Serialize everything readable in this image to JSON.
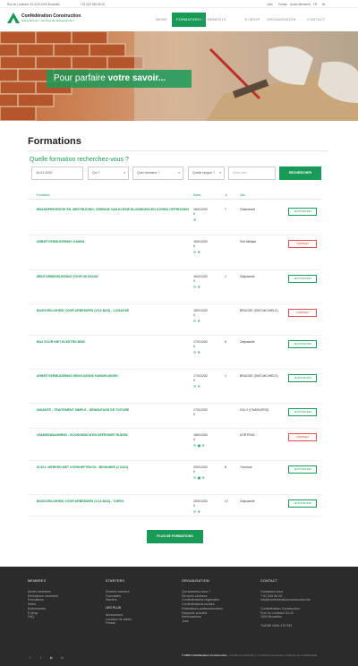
{
  "topbar": {
    "address": "Rue du Lombard, 34-42 B-1000 Bruxelles",
    "phone": "+32 (0)2 545 56 00",
    "links": [
      "Jobs",
      "Presse",
      "Accès Membres",
      "FR",
      "NL"
    ]
  },
  "header": {
    "logo_title": "Confédération Construction",
    "logo_sub": "Entrepreneurs · Services de développement",
    "nav": [
      "NEWS",
      "FORMATIONS",
      "EVENEMENTS",
      "E-SHOP",
      "ORGANISATION",
      "CONTACT"
    ],
    "active_nav": "FORMATIONS"
  },
  "hero": {
    "text_light": "Pour parfaire",
    "text_bold": "votre savoir..."
  },
  "page_title": "Formations",
  "search": {
    "question": "Quelle formation recherchez-vous ?",
    "date": "16-01-2020",
    "who": "Qui ?",
    "domain": "Quel domaine ?",
    "language": "Quelle langue ?",
    "keyword_placeholder": "Mots-clés",
    "button": "RECHERCHER"
  },
  "table_headers": {
    "formation": "Formation",
    "dates": "Dates",
    "count": "Jr",
    "place": "Lieu"
  },
  "rows": [
    {
      "title": "BRANDPREVENTIE EN -BESTRIJDING, GEBRUIK VAN KLEINE BLUSMIDDELEN & EHBO OPPRISSING",
      "date": "16/01/202 0",
      "count": "7",
      "place": "Gharmbrait",
      "icons": "❄",
      "action": "JE M'INSCRIS"
    },
    {
      "title": "ARBEITVERMIJDERING OANEN",
      "date": "16/01/202 0",
      "count": "",
      "place": "Sint-Niklaas",
      "icons": "⟳ ❄",
      "action": "COMPLET"
    },
    {
      "title": "MENTORBEGELEIDING VOOR DE BOUW",
      "date": "16/01/202 0",
      "count": "1",
      "place": "Zwijnaarde",
      "icons": "⟳ ❄",
      "action": "JE M'INSCRIS"
    },
    {
      "title": "BASISVEILIGHEID VOOR ARBEIDERS (VCA BAS) - 1-DAAGSE",
      "date": "16/01/202 0",
      "count": "",
      "place": "BRUGGE (SINT-MICHIELS)",
      "icons": "⟳ ❄",
      "action": "COMPLET"
    },
    {
      "title": "BA4 VOOR NIET-ELEKTRICIENS",
      "date": "17/01/202 0",
      "count": "5",
      "place": "Zwijnaarde",
      "icons": "⟳ ❄",
      "action": "JE M'INSCRIS"
    },
    {
      "title": "ARBEITVERMIJDERING EENVOUDIGE HANDELINGEN",
      "date": "17/01/202 0",
      "count": "1",
      "place": "BRUGGE (SINT-MICHIELS)",
      "icons": "⟳ ❄",
      "action": "JE M'INSCRIS"
    },
    {
      "title": "AMIANTE - TRAITEMENT SIMPLE - DÉMONTAGE DE TOITURE",
      "date": "17/01/202 0",
      "count": "",
      "place": "GILLY (CHARLEROI)",
      "icons": "",
      "action": "JE M'INSCRIS"
    },
    {
      "title": "VAKBEKWAAMHEID - ECONOMISCH EN DEFENSIEF RIJDEN",
      "date": "18/01/202 0",
      "count": "",
      "place": "KORTRIJK",
      "icons": "⟳ ▣ ❄",
      "action": "COMPLET"
    },
    {
      "title": "IS 801: WERKEN MET VORKHEFTRUCK - BEGINNER (2 DAG)",
      "date": "20/01/202 0",
      "count": "8",
      "place": "Turnhout",
      "icons": "⟳ ▣ ❄",
      "action": "JE M'INSCRIS"
    },
    {
      "title": "BASISVEILIGHEID VOOR ARBEIDERS (VCA BAS) - TURKS",
      "date": "20/01/202 0",
      "count": "17",
      "place": "Zwijnaarde",
      "icons": "⟳ ❄",
      "action": "JE M'INSCRIS"
    }
  ],
  "more_button": "PLUS DE FORMATIONS",
  "footer": {
    "col1": {
      "title": "MEMBRES",
      "items": [
        "Accès membres",
        "Réductions membres",
        "Formations",
        "News",
        "Evénements",
        "E-shop",
        "FAQ"
      ]
    },
    "col2": {
      "title": "STARTERS",
      "items": [
        "Devenir membre",
        "Formalités",
        "Starters"
      ],
      "sub": "LES PLUS",
      "sub_items": [
        "Annonceurs",
        "Location de salles",
        "Presse"
      ]
    },
    "col3": {
      "title": "ORGANISATION",
      "items": [
        "Qui sommes-nous ?",
        "Services centraux",
        "Confédérations régionales",
        "Confédérations locales",
        "Fédérations professionnelles",
        "Rapports annuels",
        "Memorandum",
        "Jobs"
      ]
    },
    "col4": {
      "title": "CONTACT",
      "items": [
        "Contactez-nous",
        "T 02 545 56 00",
        "info@confederationconstruction.be",
        "",
        "Confédération Construction",
        "Rue du Lombard 34-42",
        "1000 Bruxelles",
        "",
        "TVA BE 0406 479 092"
      ]
    },
    "social": [
      "f",
      "t",
      "▶",
      "in"
    ],
    "copyright_bold": "© 2020 Confédération Construction",
    "copyright_rest": " | Conditions d'utilisation | Conditions Générales | Politique de confidentialité"
  },
  "colors": {
    "accent": "#1a9a57",
    "footer_bg": "#2b2b2b",
    "complete": "#e05050"
  }
}
